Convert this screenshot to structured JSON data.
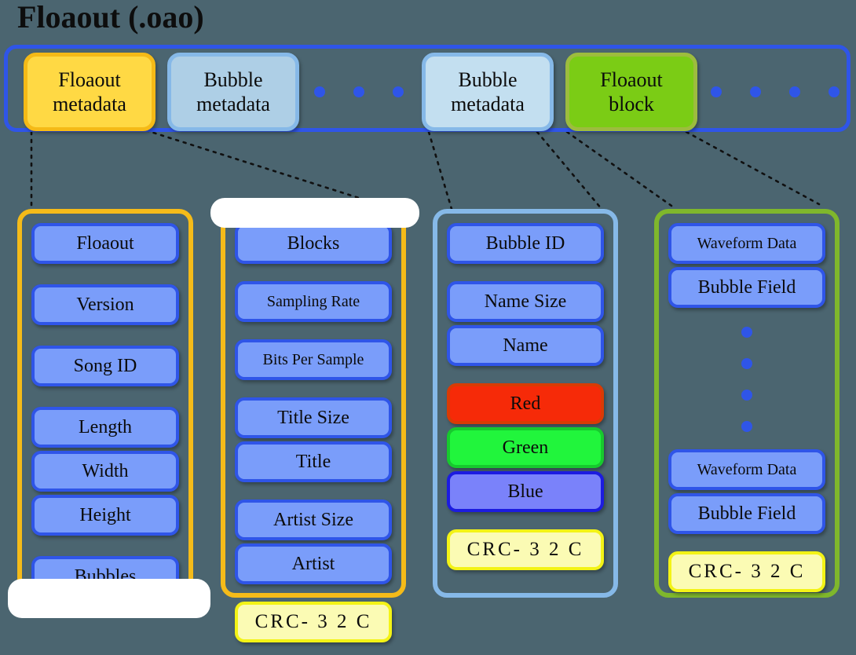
{
  "title": "Floaout (.oao)",
  "colors": {
    "background": "#4b6570",
    "blue_border": "#2f55e8",
    "blue_fill": "#7a9dfa",
    "yellow_fill": "#ffd944",
    "yellow_border": "#f5bb19",
    "lightblue_fill": "#aecfe6",
    "lightblue_border": "#86b9e8",
    "green_fill": "#7bcc15",
    "green_border": "#7fb72c",
    "red_fill": "#f62a08",
    "green_field_fill": "#21f53c",
    "blue_field_fill": "#7a82fa",
    "crc_fill": "#fbfbb4",
    "crc_border": "#f3f316"
  },
  "top_bar": {
    "boxes": [
      {
        "id": "floaout-metadata",
        "line1": "Floaout",
        "line2": "metadata"
      },
      {
        "id": "bubble-metadata-1",
        "line1": "Bubble",
        "line2": "metadata"
      },
      {
        "id": "bubble-metadata-2",
        "line1": "Bubble",
        "line2": "metadata"
      },
      {
        "id": "floaout-block",
        "line1": "Floaout",
        "line2": "block"
      }
    ],
    "ellipsis_left_dots": 3,
    "ellipsis_right_dots": 4
  },
  "columns": [
    {
      "id": "floaout-metadata",
      "accent": "#f5bb19",
      "fields": [
        {
          "label": "Floaout",
          "style": "normal",
          "gap": "lg"
        },
        {
          "label": "Version",
          "style": "normal",
          "gap": "lg"
        },
        {
          "label": "Song ID",
          "style": "normal",
          "gap": "lg"
        },
        {
          "label": "Length",
          "style": "normal",
          "gap": "none"
        },
        {
          "label": "Width",
          "style": "normal",
          "gap": "none"
        },
        {
          "label": "Height",
          "style": "normal",
          "gap": "lg"
        },
        {
          "label": "Bubbles",
          "style": "normal",
          "gap": "none"
        }
      ]
    },
    {
      "id": "blocks",
      "accent": "#f5bb19",
      "fields": [
        {
          "label": "Blocks",
          "style": "normal",
          "gap": "md"
        },
        {
          "label": "Sampling Rate",
          "style": "small",
          "gap": "md"
        },
        {
          "label": "Bits Per Sample",
          "style": "small",
          "gap": "md"
        },
        {
          "label": "Title Size",
          "style": "normal",
          "gap": "none"
        },
        {
          "label": "Title",
          "style": "normal",
          "gap": "md"
        },
        {
          "label": "Artist Size",
          "style": "normal",
          "gap": "none"
        },
        {
          "label": "Artist",
          "style": "normal",
          "gap": "md"
        },
        {
          "label": "CRC- 3 2 C",
          "style": "crc",
          "gap": "none"
        }
      ]
    },
    {
      "id": "bubble-metadata",
      "accent": "#86b9e8",
      "fields": [
        {
          "label": "Bubble ID",
          "style": "normal",
          "gap": "md"
        },
        {
          "label": "Name Size",
          "style": "normal",
          "gap": "none"
        },
        {
          "label": "Name",
          "style": "normal",
          "gap": "md"
        },
        {
          "label": "Red",
          "style": "red",
          "gap": "none"
        },
        {
          "label": "Green",
          "style": "green",
          "gap": "none"
        },
        {
          "label": "Blue",
          "style": "blue",
          "gap": "md"
        },
        {
          "label": "CRC- 3 2 C",
          "style": "crc",
          "gap": "none"
        }
      ]
    },
    {
      "id": "floaout-block",
      "accent": "#7fb72c",
      "fields": [
        {
          "label": "Waveform Data",
          "style": "small",
          "gap": "none"
        },
        {
          "label": "Bubble Field",
          "style": "normal",
          "gap": "dots"
        },
        {
          "label": "Waveform Data",
          "style": "small",
          "gap": "none"
        },
        {
          "label": "Bubble Field",
          "style": "normal",
          "gap": "md"
        },
        {
          "label": "CRC- 3 2 C",
          "style": "crc",
          "gap": "none"
        }
      ],
      "vertical_dots": 4
    }
  ]
}
